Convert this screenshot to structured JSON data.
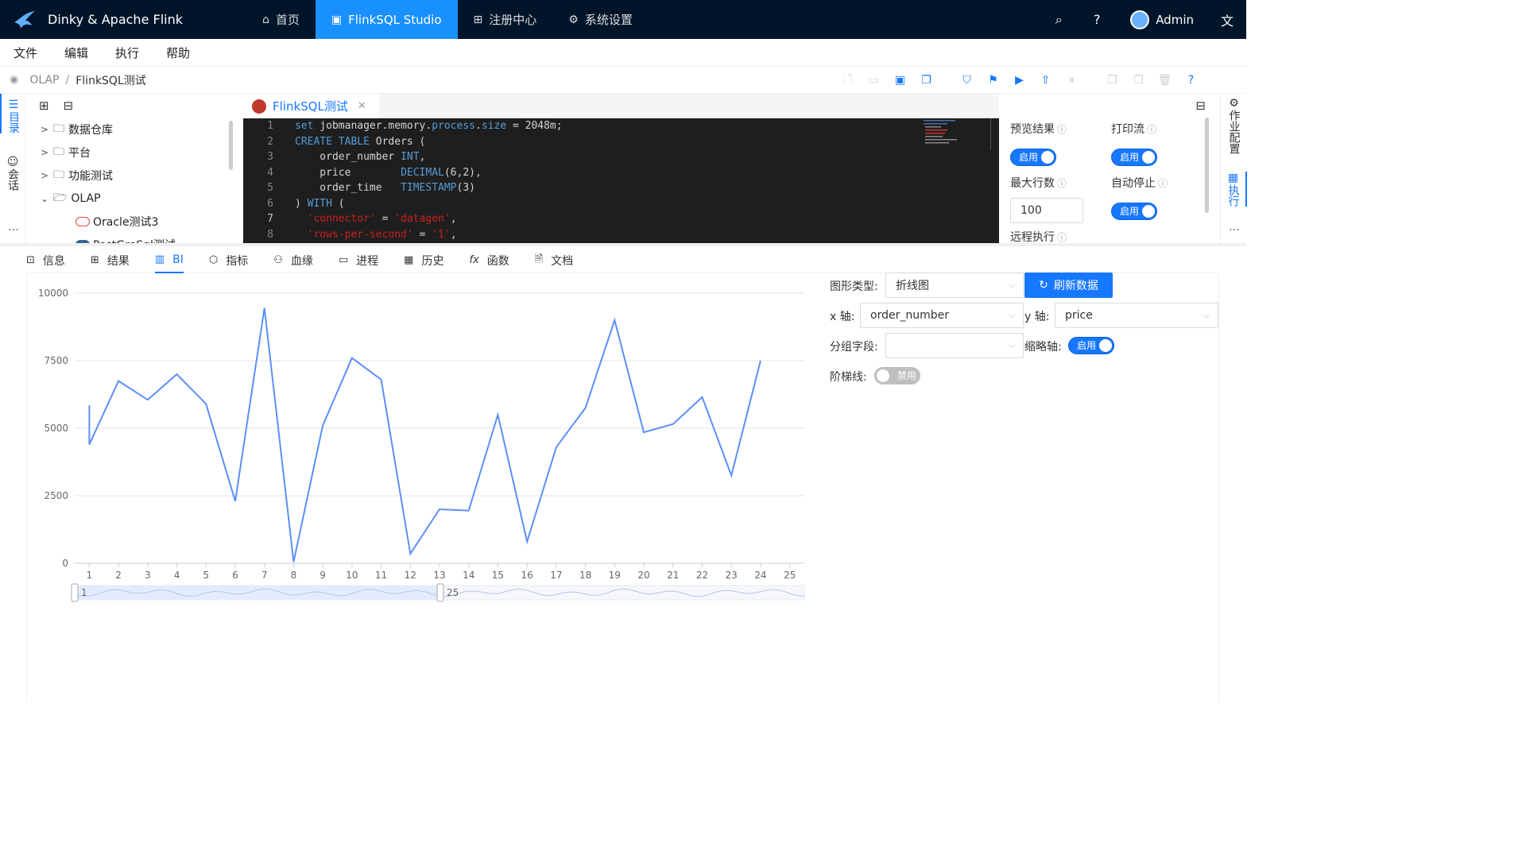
{
  "app": {
    "title": "Dinky & Apache Flink"
  },
  "nav": [
    {
      "label": "首页",
      "icon": "home-icon",
      "active": false
    },
    {
      "label": "FlinkSQL Studio",
      "icon": "console-icon",
      "active": true
    },
    {
      "label": "注册中心",
      "icon": "grid-icon",
      "active": false
    },
    {
      "label": "系统设置",
      "icon": "gear-icon",
      "active": false
    }
  ],
  "user": {
    "name": "Admin"
  },
  "menu": [
    "文件",
    "编辑",
    "执行",
    "帮助"
  ],
  "breadcrumb": [
    "OLAP",
    "FlinkSQL测试"
  ],
  "left_rail": {
    "catalog": "目录",
    "session": "会话"
  },
  "tree": {
    "items": [
      {
        "label": "数据仓库",
        "expanded": false
      },
      {
        "label": "平台",
        "expanded": false
      },
      {
        "label": "功能测试",
        "expanded": false
      },
      {
        "label": "OLAP",
        "expanded": true
      }
    ],
    "leaves": [
      "Oracle测试3",
      "PostGreSql测试"
    ]
  },
  "editor": {
    "tab_title": "FlinkSQL测试",
    "lines": [
      {
        "n": "1",
        "html_parts": [
          [
            "kw",
            "set"
          ],
          [
            "code",
            " jobmanager.memory."
          ],
          [
            "kw",
            "process"
          ],
          [
            "code",
            "."
          ],
          [
            "kw",
            "size"
          ],
          [
            "code",
            " = 2048m;"
          ]
        ]
      },
      {
        "n": "2",
        "html_parts": [
          [
            "kw",
            "CREATE"
          ],
          [
            "code",
            " "
          ],
          [
            "kw",
            "TABLE"
          ],
          [
            "code",
            " Orders ("
          ]
        ]
      },
      {
        "n": "3",
        "html_parts": [
          [
            "code",
            "    order_number "
          ],
          [
            "kw",
            "INT"
          ],
          [
            "code",
            ","
          ]
        ]
      },
      {
        "n": "4",
        "html_parts": [
          [
            "code",
            "    price        "
          ],
          [
            "kw",
            "DECIMAL"
          ],
          [
            "code",
            "(6,2),"
          ]
        ]
      },
      {
        "n": "5",
        "html_parts": [
          [
            "code",
            "    order_time   "
          ],
          [
            "kw",
            "TIMESTAMP"
          ],
          [
            "code",
            "(3)"
          ]
        ]
      },
      {
        "n": "6",
        "html_parts": [
          [
            "code",
            ") "
          ],
          [
            "kw",
            "WITH"
          ],
          [
            "code",
            " ("
          ]
        ]
      },
      {
        "n": "7",
        "html_parts": [
          [
            "code",
            "  "
          ],
          [
            "str",
            "'connector'"
          ],
          [
            "code",
            " = "
          ],
          [
            "str",
            "'datagen'"
          ],
          [
            "code",
            ","
          ]
        ]
      },
      {
        "n": "8",
        "html_parts": [
          [
            "code",
            "  "
          ],
          [
            "str",
            "'rows-per-second'"
          ],
          [
            "code",
            " = "
          ],
          [
            "str",
            "'1'"
          ],
          [
            "code",
            ","
          ]
        ]
      }
    ]
  },
  "config": {
    "preview_result": {
      "label": "预览结果",
      "state": "启用"
    },
    "print_stream": {
      "label": "打印流",
      "state": "启用"
    },
    "max_rows": {
      "label": "最大行数",
      "value": "100"
    },
    "auto_stop": {
      "label": "自动停止",
      "state": "启用"
    },
    "remote_exec": {
      "label": "远程执行"
    }
  },
  "right_rail": {
    "job_config": "作业配置",
    "execute": "执行"
  },
  "bottom_tabs": [
    {
      "label": "信息",
      "icon": "terminal-icon"
    },
    {
      "label": "结果",
      "icon": "table-icon"
    },
    {
      "label": "BI",
      "icon": "bar-chart-icon",
      "active": true
    },
    {
      "label": "指标",
      "icon": "metrics-icon"
    },
    {
      "label": "血缘",
      "icon": "lineage-icon"
    },
    {
      "label": "进程",
      "icon": "monitor-icon"
    },
    {
      "label": "历史",
      "icon": "calendar-icon"
    },
    {
      "label": "函数",
      "icon": "function-icon"
    },
    {
      "label": "文档",
      "icon": "doc-icon"
    }
  ],
  "bi_form": {
    "chart_type_label": "图形类型:",
    "chart_type_value": "折线图",
    "refresh_button": "刷新数据",
    "x_axis_label": "x 轴:",
    "x_axis_value": "order_number",
    "y_axis_label": "y 轴:",
    "y_axis_value": "price",
    "group_label": "分组字段:",
    "group_value": "",
    "thumb_axis_label": "缩略轴:",
    "thumb_axis_state": "启用",
    "step_line_label": "阶梯线:",
    "step_line_state": "禁用"
  },
  "chart_data": {
    "type": "line",
    "x": [
      1,
      2,
      3,
      4,
      5,
      6,
      7,
      8,
      9,
      10,
      11,
      12,
      13,
      14,
      15,
      16,
      17,
      18,
      19,
      20,
      21,
      22,
      23,
      24,
      25
    ],
    "y_ticks": [
      0,
      2500,
      5000,
      7500,
      10000
    ],
    "ylim": [
      0,
      10000
    ],
    "points": [
      [
        1,
        5850
      ],
      [
        1,
        4400
      ],
      [
        2,
        6750
      ],
      [
        3,
        6050
      ],
      [
        4,
        7000
      ],
      [
        5,
        5900
      ],
      [
        6,
        2300
      ],
      [
        7,
        9450
      ],
      [
        8,
        50
      ],
      [
        9,
        5100
      ],
      [
        10,
        7600
      ],
      [
        11,
        6800
      ],
      [
        12,
        350
      ],
      [
        13,
        2000
      ],
      [
        14,
        1950
      ],
      [
        15,
        5500
      ],
      [
        16,
        800
      ],
      [
        17,
        4300
      ],
      [
        18,
        5750
      ],
      [
        19,
        9000
      ],
      [
        20,
        4850
      ],
      [
        21,
        5150
      ],
      [
        22,
        6150
      ],
      [
        23,
        3250
      ],
      [
        24,
        7500
      ]
    ],
    "zoom_range": [
      "1",
      "25"
    ],
    "grid": true,
    "color": "#5b8ff9"
  }
}
